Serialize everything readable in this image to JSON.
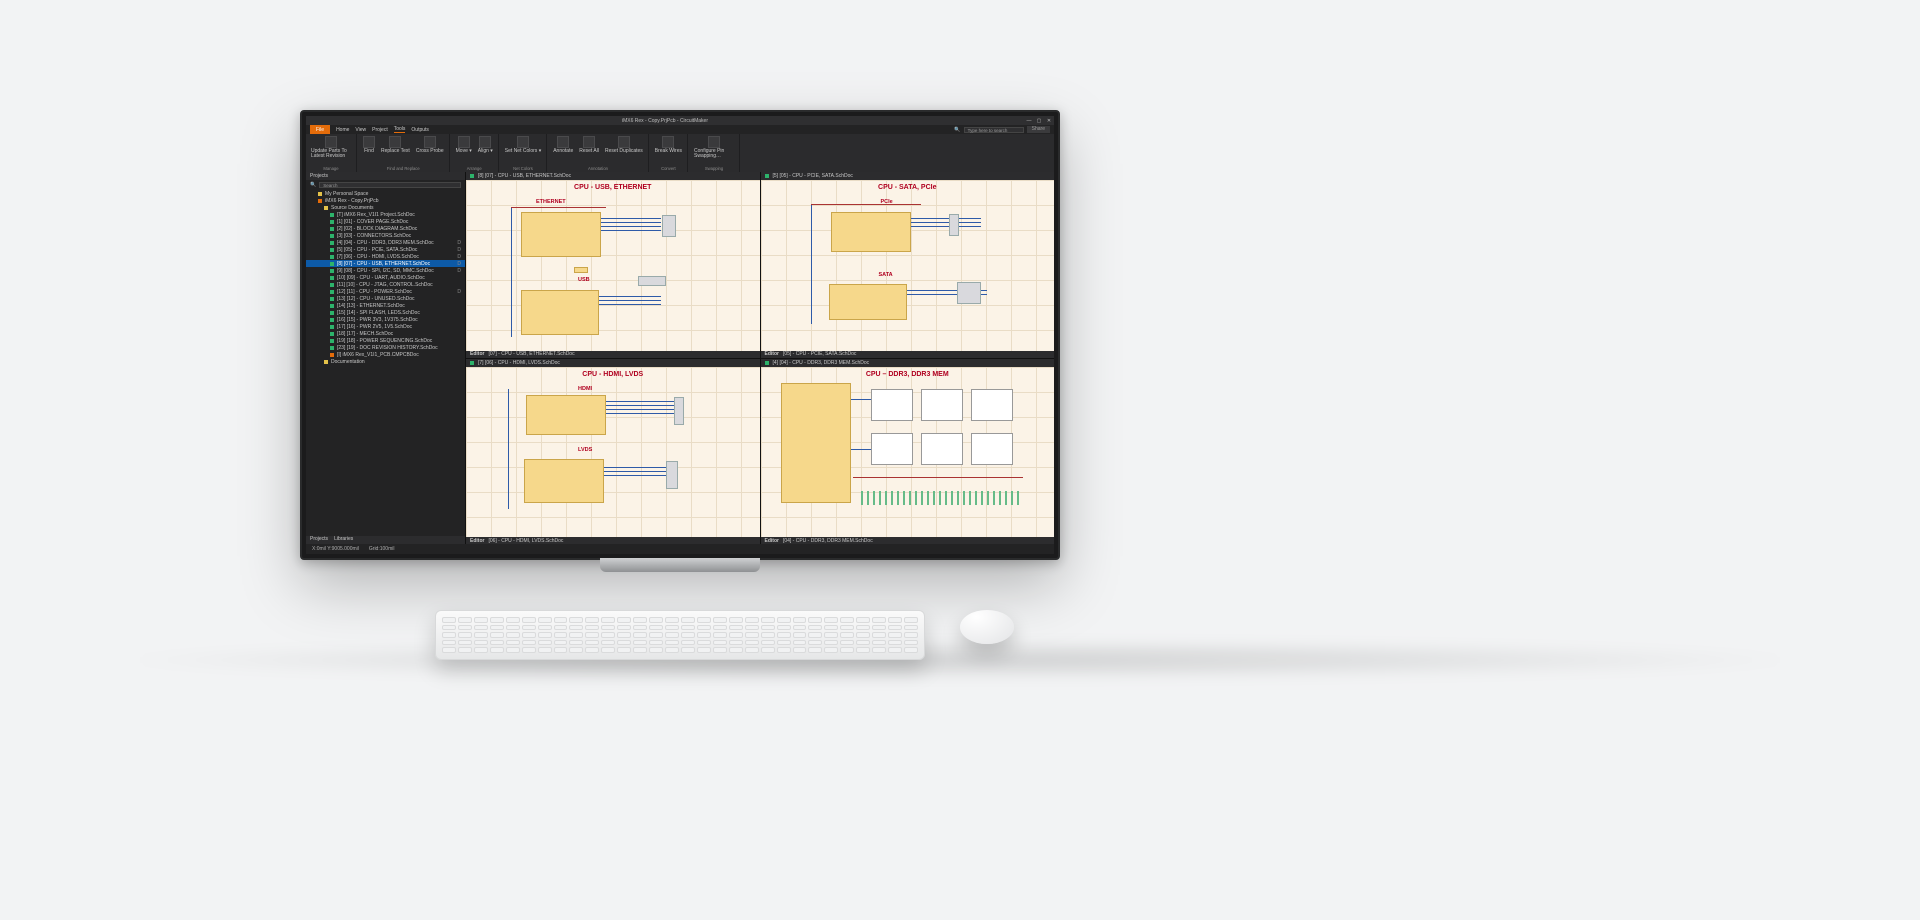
{
  "window": {
    "title": "iMX6 Rex - Copy.PrjPcb - CircuitMaker",
    "buttons": {
      "min": "—",
      "max": "▢",
      "close": "✕"
    }
  },
  "menu": {
    "file": "File",
    "items": [
      "Home",
      "View",
      "Project",
      "Tools",
      "Outputs"
    ],
    "active": "Tools",
    "search_placeholder": "Type here to search",
    "share": "Share"
  },
  "ribbon": {
    "groups": [
      {
        "label": "Manage",
        "buttons": [
          "Update Parts To Latest Revision"
        ]
      },
      {
        "label": "Find and Replace",
        "buttons": [
          "Find",
          "Replace Text",
          "Cross Probe"
        ]
      },
      {
        "label": "Arrange",
        "buttons": [
          "Move ▾",
          "Align ▾"
        ]
      },
      {
        "label": "Net Colors",
        "buttons": [
          "Set Net Colors ▾"
        ]
      },
      {
        "label": "Annotation",
        "buttons": [
          "Annotate",
          "Reset All",
          "Reset Duplicates"
        ]
      },
      {
        "label": "Convert",
        "buttons": [
          "Break Wires"
        ]
      },
      {
        "label": "Swapping",
        "buttons": [
          "Configure Pin Swapping…"
        ]
      }
    ]
  },
  "sidebar": {
    "panel": "Projects",
    "search_label": "Search",
    "root": "My Personal Space",
    "project": "iMX6 Rex - Copy.PrjPcb",
    "src_folder": "Source Documents",
    "docs": [
      {
        "label": "[T] iMX6 Rex_V1I1 Project.SchDoc",
        "type": "doc",
        "badge": ""
      },
      {
        "label": "[1] [01] - COVER PAGE.SchDoc",
        "type": "doc",
        "badge": ""
      },
      {
        "label": "[2] [02] - BLOCK DIAGRAM.SchDoc",
        "type": "doc",
        "badge": ""
      },
      {
        "label": "[3] [03] - CONNECTORS.SchDoc",
        "type": "doc",
        "badge": ""
      },
      {
        "label": "[4] [04] - CPU - DDR3, DDR3 MEM.SchDoc",
        "type": "doc",
        "badge": "D"
      },
      {
        "label": "[5] [05] - CPU - PCIE, SATA.SchDoc",
        "type": "doc",
        "badge": "D"
      },
      {
        "label": "[7] [06] - CPU - HDMI, LVDS.SchDoc",
        "type": "doc",
        "badge": "D"
      },
      {
        "label": "[8] [07] - CPU - USB, ETHERNET.SchDoc",
        "type": "doc",
        "selected": true,
        "badge": "D"
      },
      {
        "label": "[9] [08] - CPU - SPI, I2C, SD, MMC.SchDoc",
        "type": "doc",
        "badge": "D"
      },
      {
        "label": "[10] [09] - CPU - UART, AUDIO.SchDoc",
        "type": "doc",
        "badge": ""
      },
      {
        "label": "[11] [10] - CPU - JTAG, CONTROL.SchDoc",
        "type": "doc",
        "badge": ""
      },
      {
        "label": "[12] [11] - CPU - POWER.SchDoc",
        "type": "doc",
        "badge": "D"
      },
      {
        "label": "[13] [12] - CPU - UNUSED.SchDoc",
        "type": "doc",
        "badge": ""
      },
      {
        "label": "[14] [13] - ETHERNET.SchDoc",
        "type": "doc",
        "badge": ""
      },
      {
        "label": "[15] [14] - SPI FLASH, LEDS.SchDoc",
        "type": "doc",
        "badge": ""
      },
      {
        "label": "[16] [15] - PWR 3V3, 1V375.SchDoc",
        "type": "doc",
        "badge": ""
      },
      {
        "label": "[17] [16] - PWR 2V5, 1V5.SchDoc",
        "type": "doc",
        "badge": ""
      },
      {
        "label": "[18] [17] - MECH.SchDoc",
        "type": "doc",
        "badge": ""
      },
      {
        "label": "[19] [18] - POWER SEQUENCING.SchDoc",
        "type": "doc",
        "badge": ""
      },
      {
        "label": "[23] [19] - DOC REVISION HISTORY.SchDoc",
        "type": "doc",
        "badge": ""
      },
      {
        "label": "[I] iMX6 Rex_V1I1_PCB.CMPCBDoc",
        "type": "pcb",
        "badge": ""
      }
    ],
    "doc_folder": "Documentation",
    "tabs": [
      "Projects",
      "Libraries"
    ]
  },
  "canvas": {
    "tl": {
      "tab": "[8] [07] - CPU - USB, ETHERNET.SchDoc",
      "title": "CPU - USB, ETHERNET",
      "subs": [
        "ETHERNET",
        "USB"
      ],
      "footer": "[07] - CPU - USB, ETHERNET.SchDoc",
      "editor": "Editor"
    },
    "tr": {
      "tab": "[5] [05] - CPU - PCIE, SATA.SchDoc",
      "title": "CPU - SATA, PCIe",
      "subs": [
        "PCIe",
        "SATA"
      ],
      "footer": "[05] - CPU - PCIE, SATA.SchDoc",
      "editor": "Editor"
    },
    "bl": {
      "tab": "[7] [06] - CPU - HDMI, LVDS.SchDoc",
      "title": "CPU - HDMI, LVDS",
      "subs": [
        "HDMI",
        "LVDS"
      ],
      "footer": "[06] - CPU - HDMI, LVDS.SchDoc",
      "editor": "Editor"
    },
    "br": {
      "tab": "[4] [04] - CPU - DDR3, DDR3 MEM.SchDoc",
      "title": "CPU – DDR3, DDR3 MEM",
      "footer": "[04] - CPU - DDR3, DDR3 MEM.SchDoc",
      "editor": "Editor"
    }
  },
  "status": {
    "coords": "X:0mil Y:9005.000mil",
    "grid": "Grid:100mil"
  }
}
